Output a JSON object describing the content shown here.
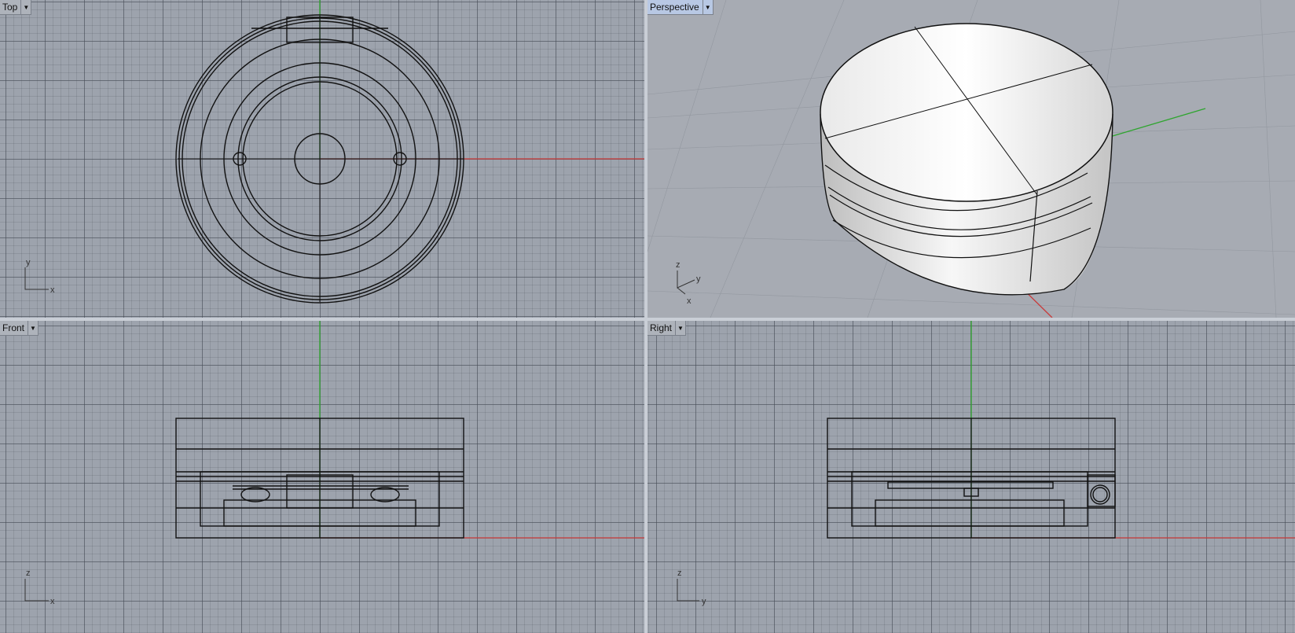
{
  "viewports": {
    "top": {
      "label": "Top",
      "axis_h": "x",
      "axis_v": "y"
    },
    "persp": {
      "label": "Perspective",
      "axis_a": "z",
      "axis_b": "y",
      "axis_c": "x"
    },
    "front": {
      "label": "Front",
      "axis_h": "x",
      "axis_v": "z"
    },
    "right": {
      "label": "Right",
      "axis_h": "y",
      "axis_v": "z"
    }
  },
  "icons": {
    "menu": "dropdown-arrow-icon"
  },
  "colors": {
    "x_axis": "#c83a3a",
    "y_axis": "#2fa52f",
    "background": "#9da3ad",
    "active_label": "#b8c8e4"
  }
}
